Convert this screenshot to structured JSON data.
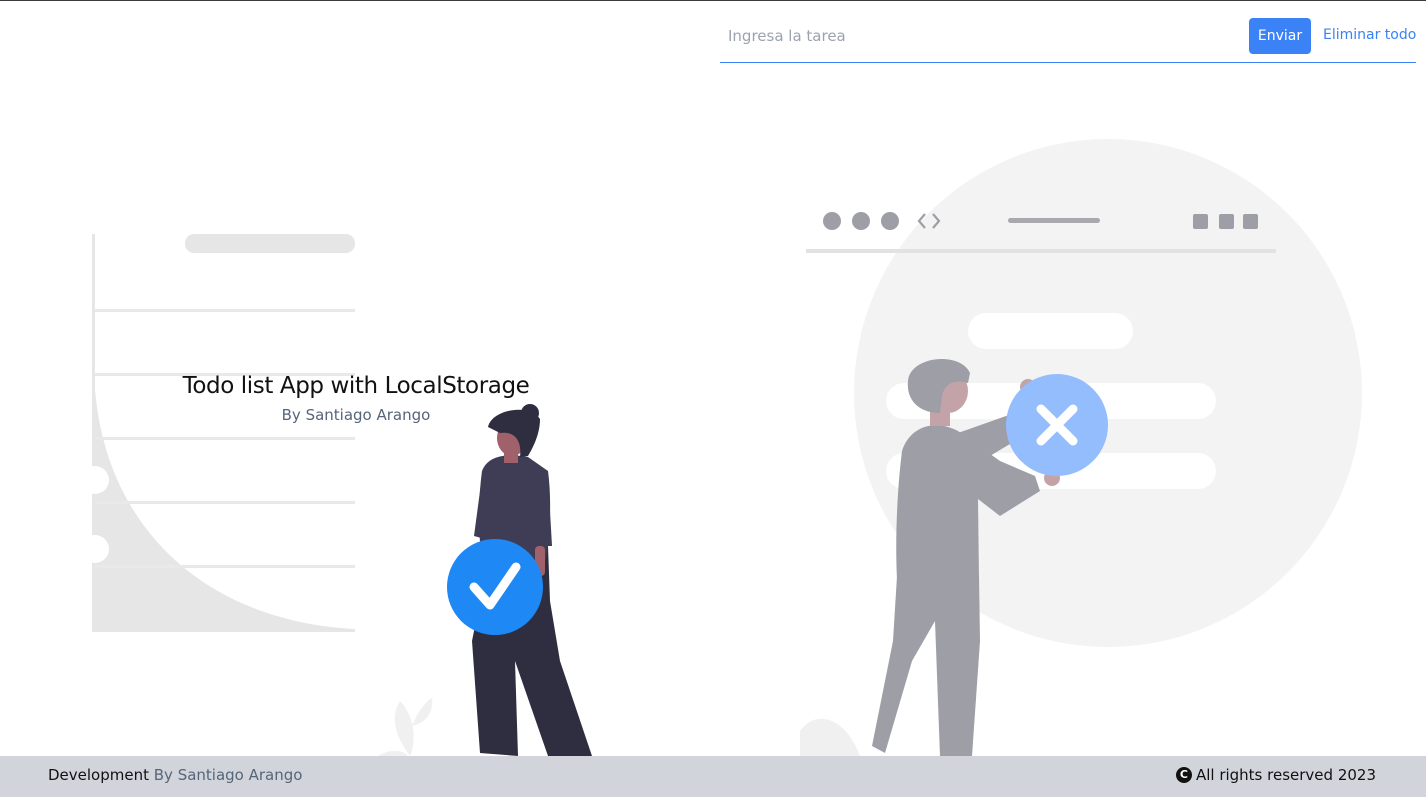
{
  "form": {
    "task_placeholder": "Ingresa la tarea",
    "task_value": "",
    "send_label": "Enviar",
    "clear_label": "Eliminar todo"
  },
  "hero": {
    "title": "Todo list App with LocalStorage",
    "subtitle": "By Santiago Arango"
  },
  "footer": {
    "prefix": "Development",
    "author": "By Santiago Arango",
    "copyright_icon": "copyright-icon",
    "rights": "All rights reserved 2023"
  },
  "icons": {
    "check": "check-icon",
    "close": "close-icon",
    "window_dots": "window-dots-icon",
    "code": "code-icon"
  },
  "colors": {
    "accent": "#3b82f6",
    "check_circle": "#1e88f5",
    "x_circle": "#93bdfd",
    "footer_bg": "#d1d5db",
    "illustration_gray": "#e6e6e6"
  }
}
